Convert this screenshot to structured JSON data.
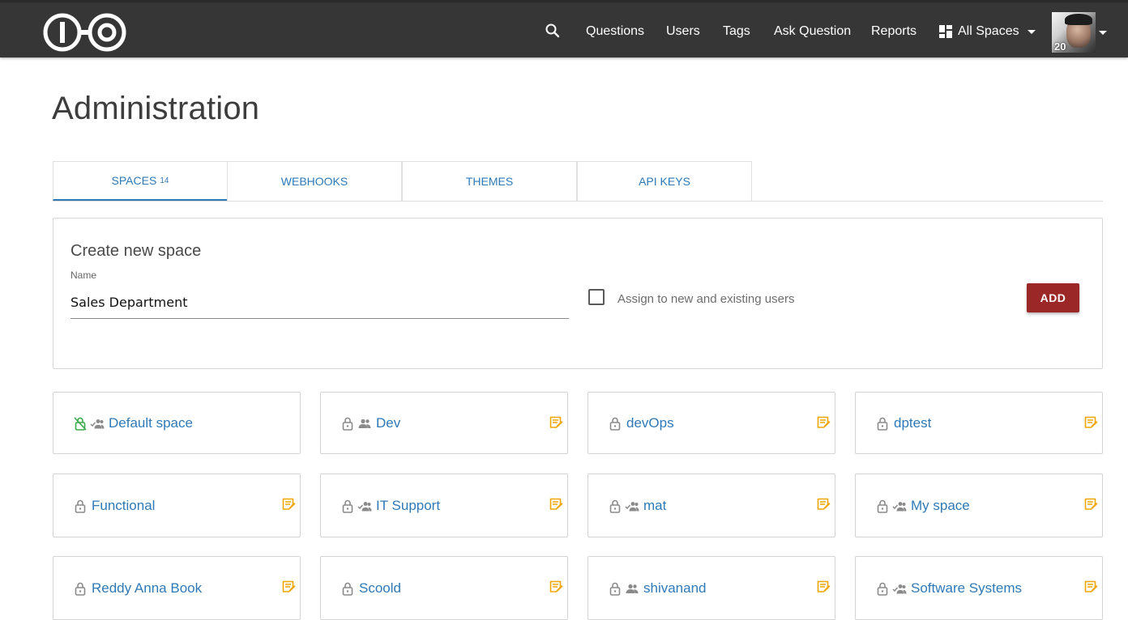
{
  "navbar": {
    "links": {
      "questions": "Questions",
      "users": "Users",
      "tags": "Tags",
      "ask": "Ask Question",
      "reports": "Reports"
    },
    "spaces_menu": "All Spaces",
    "avatar_badge": "20"
  },
  "page": {
    "title": "Administration"
  },
  "tabs": {
    "spaces": "SPACES",
    "spaces_count": "14",
    "webhooks": "WEBHOOKS",
    "themes": "THEMES",
    "api_keys": "API KEYS",
    "active": "spaces"
  },
  "create": {
    "title": "Create new space",
    "name_label": "Name",
    "name_value": "Sales Department",
    "assign_label": "Assign to new and existing users",
    "assign_checked": false,
    "add_label": "ADD"
  },
  "spaces": [
    {
      "name": "Default space",
      "icons": [
        "lock-open-icon",
        "users-assigned-icon"
      ],
      "editable": false
    },
    {
      "name": "Dev",
      "icons": [
        "lock-icon",
        "users-icon"
      ],
      "editable": true
    },
    {
      "name": "devOps",
      "icons": [
        "lock-icon"
      ],
      "editable": true
    },
    {
      "name": "dptest",
      "icons": [
        "lock-icon"
      ],
      "editable": true
    },
    {
      "name": "Functional",
      "icons": [
        "lock-icon"
      ],
      "editable": true
    },
    {
      "name": "IT Support",
      "icons": [
        "lock-icon",
        "users-assigned-icon"
      ],
      "editable": true
    },
    {
      "name": "mat",
      "icons": [
        "lock-icon",
        "users-assigned-icon"
      ],
      "editable": true
    },
    {
      "name": "My space",
      "icons": [
        "lock-icon",
        "users-assigned-icon"
      ],
      "editable": true
    },
    {
      "name": "Reddy Anna Book",
      "icons": [
        "lock-icon"
      ],
      "editable": true
    },
    {
      "name": "Scoold",
      "icons": [
        "lock-icon"
      ],
      "editable": true
    },
    {
      "name": "shivanand",
      "icons": [
        "lock-icon",
        "users-icon"
      ],
      "editable": true
    },
    {
      "name": "Software Systems",
      "icons": [
        "lock-icon",
        "users-assigned-icon"
      ],
      "editable": true
    }
  ],
  "colors": {
    "navbar": "#363636",
    "link": "#2f79b7",
    "add_button": "#9c2727",
    "edit_icon": "#f0a500",
    "default_space_lock": "#3aaa4a"
  }
}
